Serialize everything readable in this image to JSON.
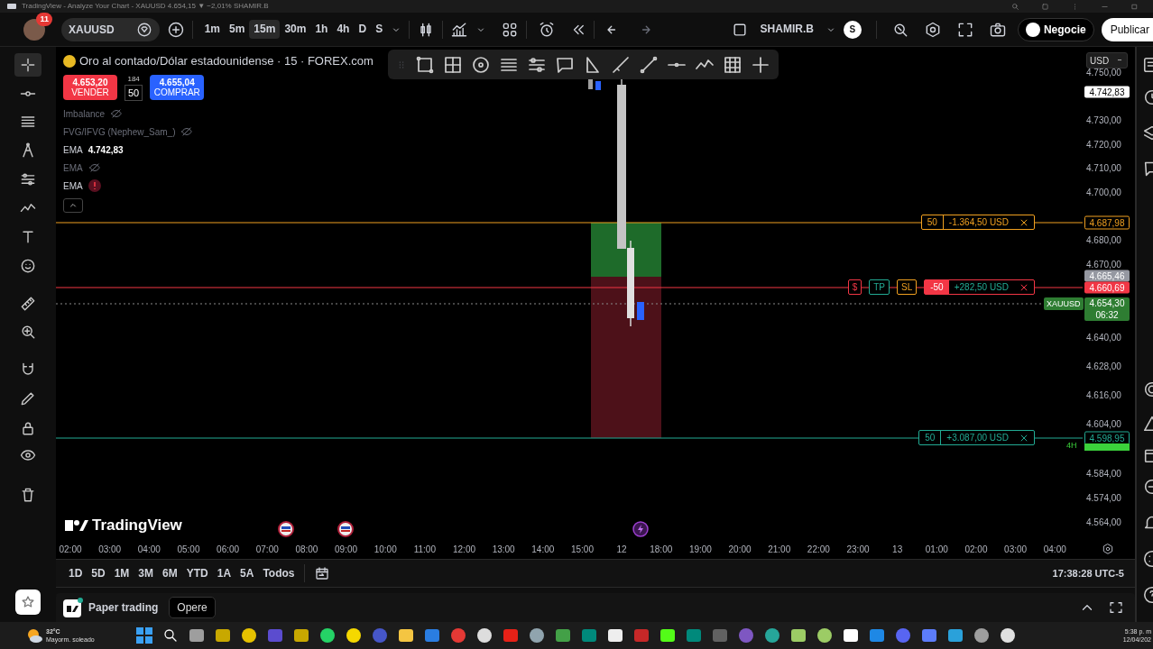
{
  "window": {
    "title": "TradingView - Analyze Your Chart - XAUUSD 4.654,15 ▼ −2,01% SHAMIR.B"
  },
  "top_toolbar": {
    "notifications": "11",
    "symbol": "XAUUSD",
    "timeframes": [
      {
        "label": "1m",
        "selected": false
      },
      {
        "label": "5m",
        "selected": false
      },
      {
        "label": "15m",
        "selected": true
      },
      {
        "label": "30m",
        "selected": false
      },
      {
        "label": "1h",
        "selected": false
      },
      {
        "label": "4h",
        "selected": false
      },
      {
        "label": "D",
        "selected": false
      },
      {
        "label": "S",
        "selected": false
      }
    ],
    "account": "SHAMIR.B",
    "account_avatar": "S",
    "trade_button": "Negocie",
    "publish_button": "Publicar"
  },
  "left_toolbar": {
    "tools": [
      {
        "selected": true
      },
      {
        "selected": false
      },
      {
        "selected": false
      },
      {
        "selected": false
      },
      {
        "selected": false
      },
      {
        "selected": false
      },
      {
        "selected": false
      },
      {
        "selected": false
      },
      {
        "selected": false
      },
      {
        "selected": false
      },
      {
        "selected": false
      },
      {
        "selected": false
      },
      {
        "selected": false
      },
      {
        "selected": false
      },
      {
        "selected": false
      }
    ]
  },
  "legend": {
    "title": "Oro al contado/Dólar estadounidense · 15 · FOREX.com",
    "sell_price": "4.653,20",
    "sell_label": "VENDER",
    "spread": "184",
    "quantity": "50",
    "buy_price": "4.655,04",
    "buy_label": "COMPRAR",
    "indicators": [
      {
        "kind": "hidden",
        "name": "Imbalance"
      },
      {
        "kind": "hidden",
        "name": "FVG/IFVG (Nephew_Sam_)"
      },
      {
        "kind": "value",
        "name": "EMA",
        "value": "4.742,83"
      },
      {
        "kind": "hidden",
        "name": "EMA"
      },
      {
        "kind": "error",
        "name": "EMA"
      }
    ]
  },
  "chart": {
    "watermark": "TradingView",
    "orders": [
      {
        "color": "#f0a020",
        "quantity": "50",
        "quantity_filled": false,
        "pnl": {
          "text": "-1.364,50 USD",
          "color": "#f0a020"
        }
      },
      {
        "color": "#f23645",
        "quantity": "-50",
        "quantity_filled": true,
        "pnl": {
          "text": "+282,50 USD",
          "color": "#22ab94"
        },
        "chips": [
          {
            "text": "$",
            "color": "#f23645"
          },
          {
            "text": "TP",
            "color": "#22ab94"
          },
          {
            "text": "SL",
            "color": "#f0a020"
          }
        ]
      },
      {
        "color": "#22ab94",
        "quantity": "50",
        "quantity_filled": false,
        "pnl": {
          "text": "+3.087,00 USD",
          "color": "#22ab94"
        }
      }
    ],
    "price_axis": {
      "currency": "USD",
      "ticks": [
        "4.750,00",
        "4.730,00",
        "4.720,00",
        "4.710,00",
        "4.700,00",
        "4.680,00",
        "4.670,00",
        "4.640,00",
        "4.628,00",
        "4.616,00",
        "4.604,00",
        "4.584,00",
        "4.574,00",
        "4.564,00"
      ]
    },
    "price_labels": [
      {
        "text": "4.742,83",
        "color": "#ffffff",
        "kind": "filled"
      },
      {
        "text": "4.687,98",
        "color": "#f0a020",
        "kind": "outlined"
      },
      {
        "text": "4.665,46",
        "color": "#9598a1",
        "kind": "filled"
      },
      {
        "text": "4.660,69",
        "color": "#f23645",
        "kind": "filled"
      },
      {
        "text": "4.654,30",
        "color": "#2e7d32",
        "kind": "filled",
        "symbol": "XAUUSD",
        "countdown": "06:32"
      },
      {
        "text": "4.598,95",
        "color": "#22ab94",
        "kind": "outlined"
      }
    ],
    "interval_marker": "4H",
    "time_axis": [
      "02:00",
      "03:00",
      "04:00",
      "05:00",
      "06:00",
      "07:00",
      "08:00",
      "09:00",
      "10:00",
      "11:00",
      "12:00",
      "13:00",
      "14:00",
      "15:00",
      "12",
      "18:00",
      "19:00",
      "20:00",
      "21:00",
      "22:00",
      "23:00",
      "13",
      "01:00",
      "02:00",
      "03:00",
      "04:00"
    ]
  },
  "range_bar": {
    "ranges": [
      "1D",
      "5D",
      "1M",
      "3M",
      "6M",
      "YTD",
      "1A",
      "5A",
      "Todos"
    ],
    "clock": "17:38:28 UTC-5"
  },
  "bottom_panel": {
    "label": "Paper trading",
    "trade_button": "Opere"
  },
  "taskbar": {
    "temperature": "32°C",
    "weather": "Mayorm. soleado",
    "time": "5:38 p. m",
    "date": "12/04/202"
  }
}
